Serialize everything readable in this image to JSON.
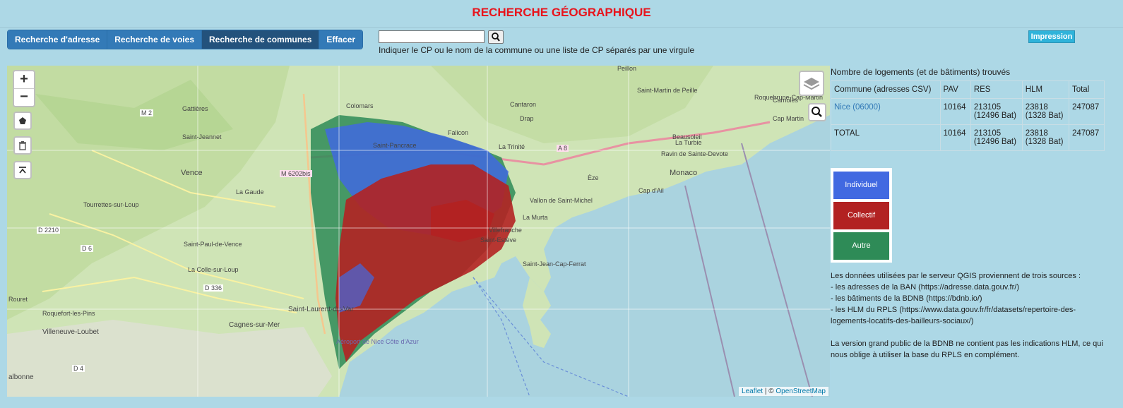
{
  "header": {
    "title": "RECHERCHE GÉOGRAPHIQUE"
  },
  "tabs": [
    {
      "label": "Recherche d'adresse"
    },
    {
      "label": "Recherche de voies"
    },
    {
      "label": "Recherche de communes"
    },
    {
      "label": "Effacer"
    }
  ],
  "search": {
    "value": "",
    "hint": "Indiquer le CP ou le nom de la commune ou une liste de CP séparés par une virgule"
  },
  "print_label": "Impression",
  "map": {
    "zoom_in": "+",
    "zoom_out": "−",
    "attribution_leaflet": "Leaflet",
    "attribution_sep": " | © ",
    "attribution_osm": "OpenStreetMap",
    "places": [
      "Gattières",
      "Saint-Jeannet",
      "Colomars",
      "Cantaron",
      "Drap",
      "Falicon",
      "Saint-Pancrace",
      "La Trinité",
      "Peillon",
      "Saint-Martin de Peille",
      "Roquebrune-Cap-Martin",
      "Carnolès",
      "Cap Martin",
      "Beausoleil",
      "La Turbie",
      "Ravin de Sainte-Devote",
      "Monaco",
      "Cap d'Ail",
      "Èze",
      "Vence",
      "La Gaude",
      "Tourrettes-sur-Loup",
      "Vallon de Saint-Michel",
      "La Murta",
      "Villefranche",
      "Saint-Estève",
      "Saint-Jean-Cap-Ferrat",
      "Saint-Paul-de-Vence",
      "La Colle-sur-Loup",
      "Roquefort-les-Pins",
      "Saint-Laurent-du-Var",
      "Cagnes-sur-Mer",
      "Villeneuve-Loubet",
      "Aéroport de Nice Côte d'Azur",
      "albonne",
      "Rouret",
      "M 2",
      "M 6202bis",
      "A 8",
      "D 2210",
      "D 6",
      "D 336",
      "D 4"
    ]
  },
  "results": {
    "heading": "Nombre de logements (et de bâtiments) trouvés",
    "columns": [
      "Commune (adresses CSV)",
      "PAV",
      "RES",
      "HLM",
      "Total"
    ],
    "rows": [
      {
        "commune": "Nice (06000)",
        "pav": "10164",
        "res": "213105",
        "res_bat": "(12496 Bat)",
        "hlm": "23818",
        "hlm_bat": "(1328 Bat)",
        "total": "247087"
      },
      {
        "commune": "TOTAL",
        "pav": "10164",
        "res": "213105",
        "res_bat": "(12496 Bat)",
        "hlm": "23818",
        "hlm_bat": "(1328 Bat)",
        "total": "247087"
      }
    ]
  },
  "legend": [
    {
      "label": "Individuel",
      "color": "#4169e1"
    },
    {
      "label": "Collectif",
      "color": "#b22222"
    },
    {
      "label": "Autre",
      "color": "#2e8b57"
    }
  ],
  "sources": {
    "intro": "Les données utilisées par le serveur QGIS proviennent de trois sources :",
    "items": [
      "- les adresses de la BAN (https://adresse.data.gouv.fr/)",
      "- les bâtiments de la BDNB (https://bdnb.io/)",
      "- les HLM du RPLS (https://www.data.gouv.fr/fr/datasets/repertoire-des-logements-locatifs-des-bailleurs-sociaux/)"
    ],
    "note": "La version grand public de la BDNB ne contient pas les indications HLM, ce qui nous oblige à utiliser la base du RPLS en complément."
  }
}
